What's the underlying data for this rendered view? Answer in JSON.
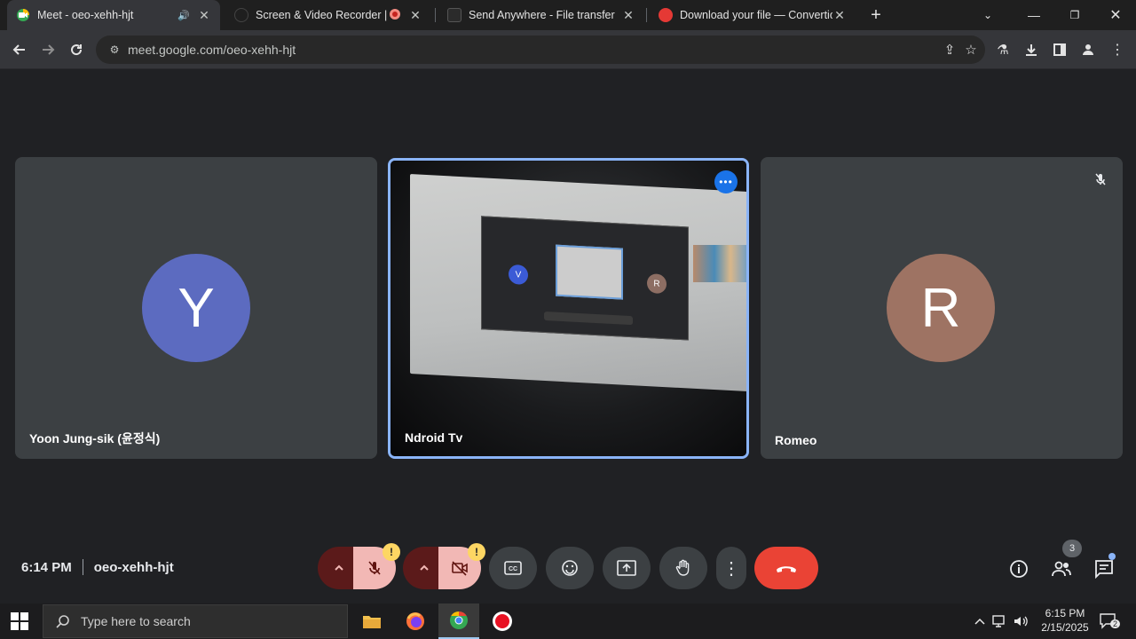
{
  "browser": {
    "tabs": [
      {
        "title": "Meet - oeo-xehh-hjt",
        "favicon": "google-meet-icon",
        "audio_icon": "speaker-icon",
        "active": true
      },
      {
        "title": "Screen & Video Recorder | R",
        "favicon": "recorder-icon",
        "audio_icon": "record-dot-icon",
        "active": false
      },
      {
        "title": "Send Anywhere - File transfer",
        "favicon": "send-anywhere-icon",
        "active": false
      },
      {
        "title": "Download your file — Convertio",
        "favicon": "convertio-icon",
        "active": false
      }
    ],
    "url": "meet.google.com/oeo-xehh-hjt"
  },
  "meet": {
    "participants": [
      {
        "name": "Yoon Jung-sik (윤정식)",
        "initial": "Y",
        "avatar_color": "#5c6bc0"
      },
      {
        "name": "Ndroid Tv",
        "has_video": true,
        "active_speaker": true
      },
      {
        "name": "Romeo",
        "initial": "R",
        "avatar_color": "#9e7363",
        "muted": true
      }
    ],
    "inner_view": {
      "left_initial": "V",
      "right_initial": "R"
    },
    "time": "6:14 PM",
    "meeting_code": "oeo-xehh-hjt",
    "people_count": "3",
    "accent_color": "#8ab4f8",
    "hangup_color": "#ea4335"
  },
  "taskbar": {
    "search_placeholder": "Type here to search",
    "time": "6:15 PM",
    "date": "2/15/2025",
    "notification_count": "2"
  }
}
